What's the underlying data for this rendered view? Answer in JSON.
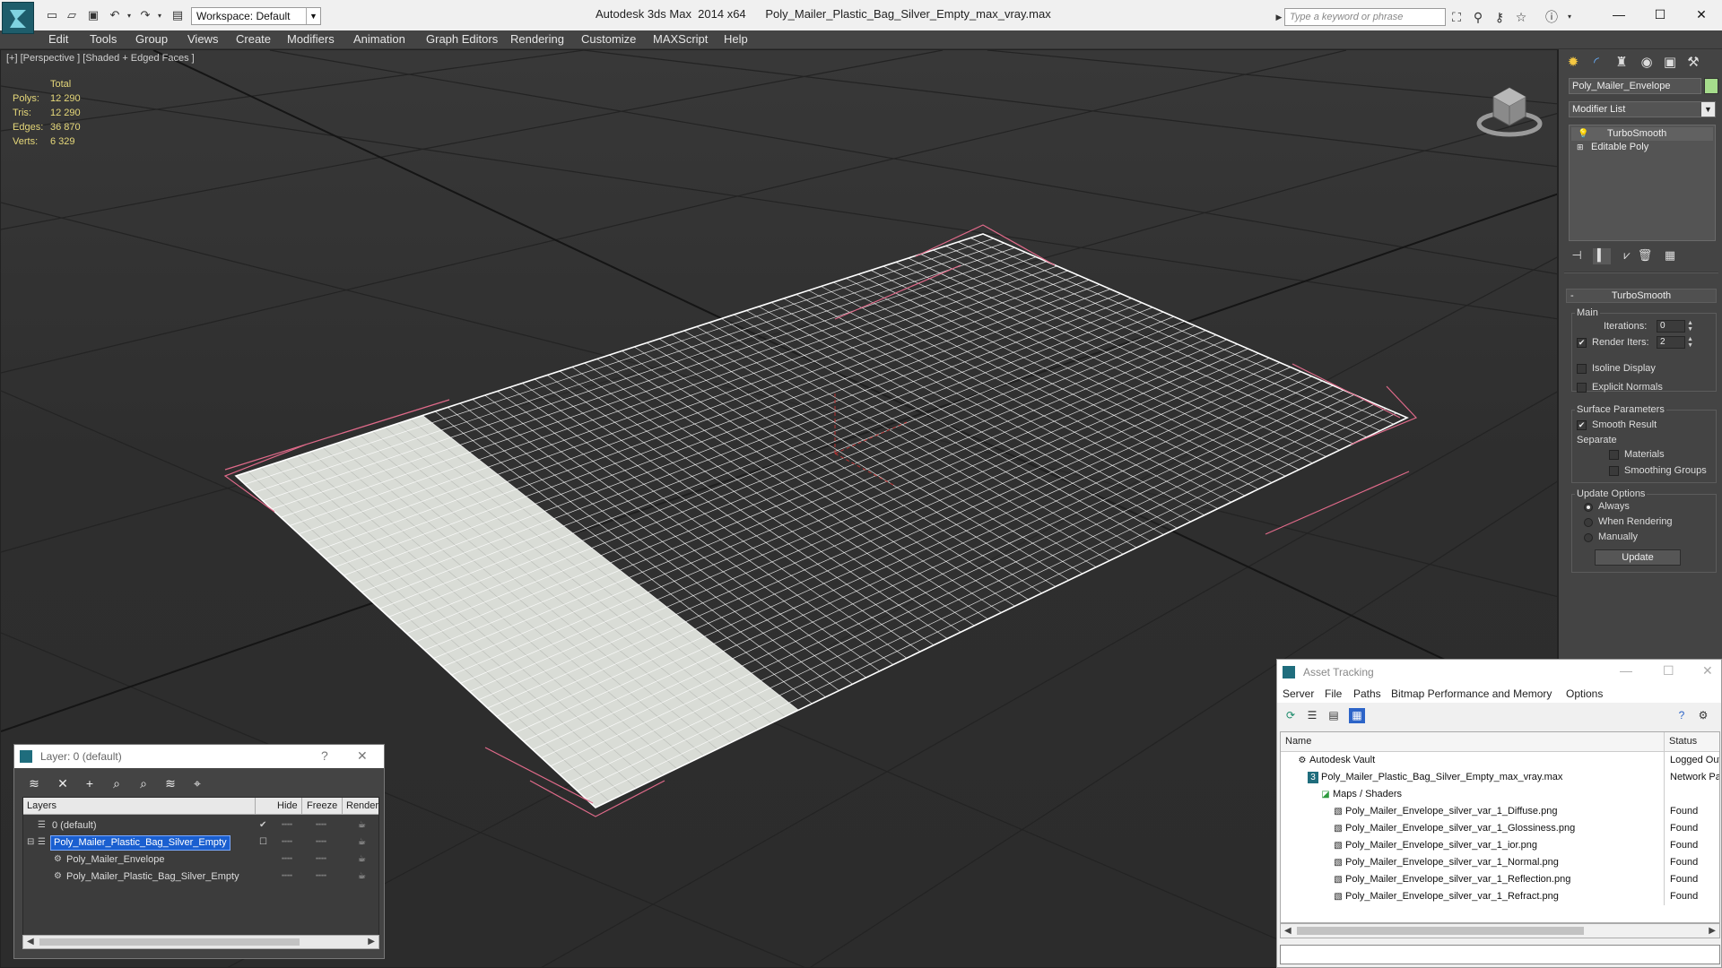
{
  "titlebar": {
    "app_title": "Autodesk 3ds Max  2014 x64",
    "file_title": "Poly_Mailer_Plastic_Bag_Silver_Empty_max_vray.max",
    "workspace": "Workspace: Default",
    "search_placeholder": "Type a keyword or phrase",
    "icons": [
      "new-file-icon",
      "open-file-icon",
      "save-icon",
      "undo-icon",
      "redo-icon",
      "project-icon",
      "binoculars-icon",
      "search-tools-icon",
      "favorites-icon",
      "help-icon"
    ]
  },
  "menubar": {
    "items": [
      "Edit",
      "Tools",
      "Group",
      "Views",
      "Create",
      "Modifiers",
      "Animation",
      "Graph Editors",
      "Rendering",
      "Customize",
      "MAXScript",
      "Help"
    ]
  },
  "viewport": {
    "label": "[+] [Perspective ] [Shaded + Edged Faces ]",
    "stats": {
      "header": "Total",
      "rows": [
        {
          "label": "Polys:",
          "value": "12 290"
        },
        {
          "label": "Tris:",
          "value": "12 290"
        },
        {
          "label": "Edges:",
          "value": "36 870"
        },
        {
          "label": "Verts:",
          "value": "6 329"
        }
      ]
    },
    "colors": {
      "stats_text": "#e6d87a",
      "selection_bracket": "#e06a8a",
      "wire": "#ffffff"
    }
  },
  "command_panel": {
    "tabs": [
      "create-icon",
      "modify-icon",
      "hierarchy-icon",
      "motion-icon",
      "display-icon",
      "utilities-icon"
    ],
    "object_name": "Poly_Mailer_Envelope",
    "object_color": "#a6dc8c",
    "modifier_list": "Modifier List",
    "stack": [
      "TurboSmooth",
      "Editable Poly"
    ],
    "rollout": {
      "title": "TurboSmooth",
      "main_group": "Main",
      "iterations_label": "Iterations:",
      "iterations_value": "0",
      "render_iters_label": "Render Iters:",
      "render_iters_value": "2",
      "isoline": "Isoline Display",
      "explicit_normals": "Explicit Normals",
      "surface_group": "Surface Parameters",
      "smooth_result": "Smooth Result",
      "separate": "Separate",
      "materials": "Materials",
      "smoothing_groups": "Smoothing Groups",
      "update_group": "Update Options",
      "always": "Always",
      "when_rendering": "When Rendering",
      "manually": "Manually",
      "update_button": "Update"
    }
  },
  "layer_dialog": {
    "title": "Layer: 0 (default)",
    "help": "?",
    "close": "✕",
    "columns": [
      "Layers",
      "Hide",
      "Freeze",
      "Render"
    ],
    "rows": [
      {
        "name": "0 (default)"
      },
      {
        "name": "Poly_Mailer_Plastic_Bag_Silver_Empty"
      },
      {
        "name": "Poly_Mailer_Envelope"
      },
      {
        "name": "Poly_Mailer_Plastic_Bag_Silver_Empty"
      }
    ]
  },
  "asset_dialog": {
    "title": "Asset Tracking",
    "menu": [
      "Server",
      "File",
      "Paths",
      "Bitmap Performance and Memory",
      "Options"
    ],
    "columns": [
      "Name",
      "Status"
    ],
    "rows": [
      {
        "name": "Autodesk Vault",
        "status": "Logged Out"
      },
      {
        "name": "Poly_Mailer_Plastic_Bag_Silver_Empty_max_vray.max",
        "status": "Network Path"
      },
      {
        "name": "Maps / Shaders",
        "status": ""
      },
      {
        "name": "Poly_Mailer_Envelope_silver_var_1_Diffuse.png",
        "status": "Found"
      },
      {
        "name": "Poly_Mailer_Envelope_silver_var_1_Glossiness.png",
        "status": "Found"
      },
      {
        "name": "Poly_Mailer_Envelope_silver_var_1_ior.png",
        "status": "Found"
      },
      {
        "name": "Poly_Mailer_Envelope_silver_var_1_Normal.png",
        "status": "Found"
      },
      {
        "name": "Poly_Mailer_Envelope_silver_var_1_Reflection.png",
        "status": "Found"
      },
      {
        "name": "Poly_Mailer_Envelope_silver_var_1_Refract.png",
        "status": "Found"
      }
    ]
  }
}
